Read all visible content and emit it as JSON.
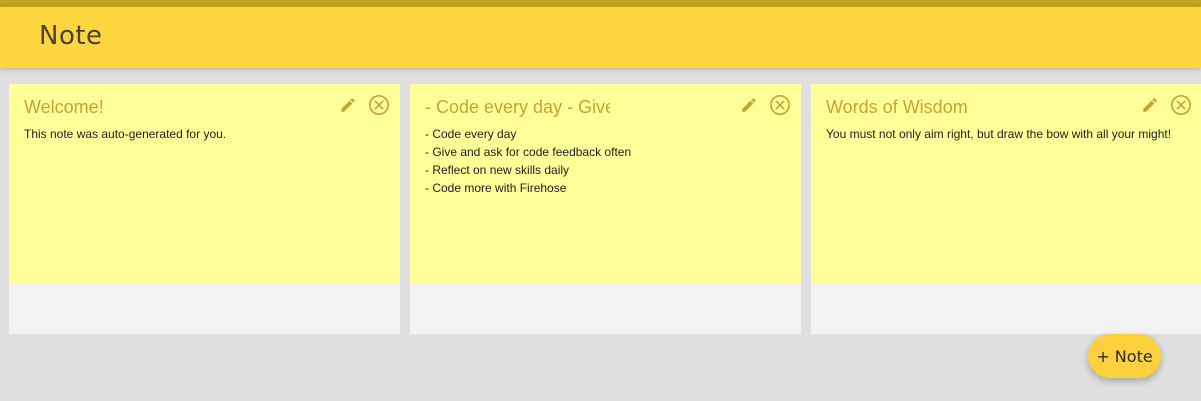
{
  "app": {
    "title": "Note"
  },
  "colors": {
    "appbar": "#fdd53f",
    "accent_strip": "#c4a21d",
    "note_background": "#ffff99",
    "note_title": "#c9a332",
    "icon": "#c9a332"
  },
  "notes": [
    {
      "title": "Welcome!",
      "text": "This note was auto-generated for you.",
      "edit_icon": "pencil-icon",
      "close_icon": "close-circle-icon"
    },
    {
      "title": "- Code every day - Give a",
      "text": "- Code every day\n- Give and ask for code feedback often\n- Reflect on new skills daily\n- Code more with Firehose",
      "edit_icon": "pencil-icon",
      "close_icon": "close-circle-icon"
    },
    {
      "title": "Words of Wisdom",
      "text": "You must not only aim right, but draw the bow with all your might!",
      "edit_icon": "pencil-icon",
      "close_icon": "close-circle-icon"
    }
  ],
  "fab": {
    "label": "+ Note"
  }
}
